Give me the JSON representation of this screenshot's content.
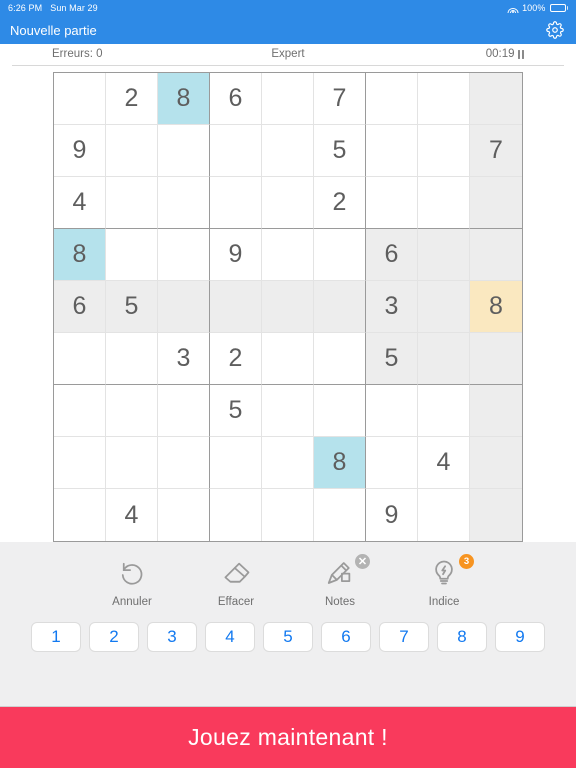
{
  "statusbar": {
    "time": "6:26 PM",
    "date": "Sun Mar 29",
    "battery_percent": "100%",
    "wifi_icon": "wifi-icon",
    "battery_icon": "battery-icon"
  },
  "navbar": {
    "title": "Nouvelle partie",
    "settings_icon": "gear-icon"
  },
  "info": {
    "errors_label": "Erreurs: 0",
    "difficulty": "Expert",
    "timer": "00:19",
    "pause_icon": "pause-icon"
  },
  "board": {
    "selected_cell": {
      "row": 5,
      "col": 9,
      "value": "8"
    },
    "highlight_colors": {
      "selected": "#fae8c0",
      "same_value": "#b5e2ec",
      "peer": "#ededed",
      "digit": "#5e5e5e",
      "thick_line": "#9a9a9a",
      "thin_line": "#e3e3e3"
    },
    "rows": [
      [
        {
          "v": "",
          "hl": ""
        },
        {
          "v": "2",
          "hl": ""
        },
        {
          "v": "8",
          "hl": "same"
        },
        {
          "v": "6",
          "hl": ""
        },
        {
          "v": "",
          "hl": ""
        },
        {
          "v": "7",
          "hl": ""
        },
        {
          "v": "",
          "hl": ""
        },
        {
          "v": "",
          "hl": ""
        },
        {
          "v": "",
          "hl": "peer"
        }
      ],
      [
        {
          "v": "9",
          "hl": ""
        },
        {
          "v": "",
          "hl": ""
        },
        {
          "v": "",
          "hl": ""
        },
        {
          "v": "",
          "hl": ""
        },
        {
          "v": "",
          "hl": ""
        },
        {
          "v": "5",
          "hl": ""
        },
        {
          "v": "",
          "hl": ""
        },
        {
          "v": "",
          "hl": ""
        },
        {
          "v": "7",
          "hl": "peer"
        }
      ],
      [
        {
          "v": "4",
          "hl": ""
        },
        {
          "v": "",
          "hl": ""
        },
        {
          "v": "",
          "hl": ""
        },
        {
          "v": "",
          "hl": ""
        },
        {
          "v": "",
          "hl": ""
        },
        {
          "v": "2",
          "hl": ""
        },
        {
          "v": "",
          "hl": ""
        },
        {
          "v": "",
          "hl": ""
        },
        {
          "v": "",
          "hl": "peer"
        }
      ],
      [
        {
          "v": "8",
          "hl": "same"
        },
        {
          "v": "",
          "hl": ""
        },
        {
          "v": "",
          "hl": ""
        },
        {
          "v": "9",
          "hl": ""
        },
        {
          "v": "",
          "hl": ""
        },
        {
          "v": "",
          "hl": ""
        },
        {
          "v": "6",
          "hl": "peer"
        },
        {
          "v": "",
          "hl": "peer"
        },
        {
          "v": "",
          "hl": "peer"
        }
      ],
      [
        {
          "v": "6",
          "hl": "peer"
        },
        {
          "v": "5",
          "hl": "peer"
        },
        {
          "v": "",
          "hl": "peer"
        },
        {
          "v": "",
          "hl": "peer"
        },
        {
          "v": "",
          "hl": "peer"
        },
        {
          "v": "",
          "hl": "peer"
        },
        {
          "v": "3",
          "hl": "peer"
        },
        {
          "v": "",
          "hl": "peer"
        },
        {
          "v": "8",
          "hl": "sel"
        }
      ],
      [
        {
          "v": "",
          "hl": ""
        },
        {
          "v": "",
          "hl": ""
        },
        {
          "v": "3",
          "hl": ""
        },
        {
          "v": "2",
          "hl": ""
        },
        {
          "v": "",
          "hl": ""
        },
        {
          "v": "",
          "hl": ""
        },
        {
          "v": "5",
          "hl": "peer"
        },
        {
          "v": "",
          "hl": "peer"
        },
        {
          "v": "",
          "hl": "peer"
        }
      ],
      [
        {
          "v": "",
          "hl": ""
        },
        {
          "v": "",
          "hl": ""
        },
        {
          "v": "",
          "hl": ""
        },
        {
          "v": "5",
          "hl": ""
        },
        {
          "v": "",
          "hl": ""
        },
        {
          "v": "",
          "hl": ""
        },
        {
          "v": "",
          "hl": ""
        },
        {
          "v": "",
          "hl": ""
        },
        {
          "v": "",
          "hl": "peer"
        }
      ],
      [
        {
          "v": "",
          "hl": ""
        },
        {
          "v": "",
          "hl": ""
        },
        {
          "v": "",
          "hl": ""
        },
        {
          "v": "",
          "hl": ""
        },
        {
          "v": "",
          "hl": ""
        },
        {
          "v": "8",
          "hl": "same"
        },
        {
          "v": "",
          "hl": ""
        },
        {
          "v": "4",
          "hl": ""
        },
        {
          "v": "",
          "hl": "peer"
        }
      ],
      [
        {
          "v": "",
          "hl": ""
        },
        {
          "v": "4",
          "hl": ""
        },
        {
          "v": "",
          "hl": ""
        },
        {
          "v": "",
          "hl": ""
        },
        {
          "v": "",
          "hl": ""
        },
        {
          "v": "",
          "hl": ""
        },
        {
          "v": "9",
          "hl": ""
        },
        {
          "v": "",
          "hl": ""
        },
        {
          "v": "",
          "hl": "peer"
        }
      ]
    ]
  },
  "tools": [
    {
      "label": "Annuler",
      "icon": "undo-icon",
      "badge": "",
      "badge_style": ""
    },
    {
      "label": "Effacer",
      "icon": "eraser-icon",
      "badge": "",
      "badge_style": ""
    },
    {
      "label": "Notes",
      "icon": "pencil-note-icon",
      "badge": "✕",
      "badge_style": "gray"
    },
    {
      "label": "Indice",
      "icon": "lightbulb-icon",
      "badge": "3",
      "badge_style": "orange"
    }
  ],
  "numpad": [
    "1",
    "2",
    "3",
    "4",
    "5",
    "6",
    "7",
    "8",
    "9"
  ],
  "banner": {
    "text": "Jouez maintenant !",
    "color": "#f93a5c"
  }
}
